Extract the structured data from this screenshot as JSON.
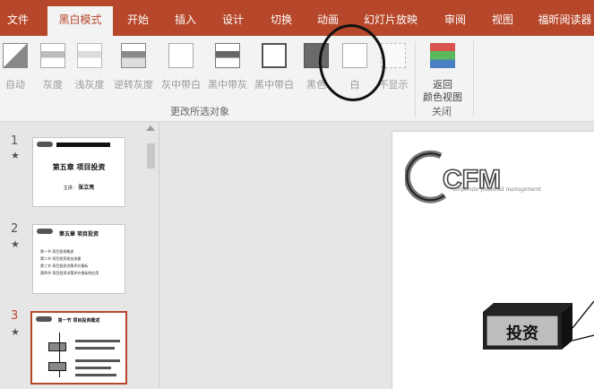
{
  "tabs": [
    {
      "label": "文件",
      "active": false
    },
    {
      "label": "黑白模式",
      "active": true
    },
    {
      "label": "开始",
      "active": false
    },
    {
      "label": "插入",
      "active": false
    },
    {
      "label": "设计",
      "active": false
    },
    {
      "label": "切换",
      "active": false
    },
    {
      "label": "动画",
      "active": false
    },
    {
      "label": "幻灯片放映",
      "active": false
    },
    {
      "label": "审阅",
      "active": false
    },
    {
      "label": "视图",
      "active": false
    },
    {
      "label": "福昕阅读器",
      "active": false
    }
  ],
  "ribbon": {
    "buttons": [
      {
        "label": "自动",
        "icon": "auto-icon"
      },
      {
        "label": "灰度",
        "icon": "grayscale-icon"
      },
      {
        "label": "浅灰度",
        "icon": "light-grayscale-icon"
      },
      {
        "label": "逆转灰度",
        "icon": "inverse-grayscale-icon"
      },
      {
        "label": "灰中带白",
        "icon": "gray-with-white-icon"
      },
      {
        "label": "黑中带灰",
        "icon": "black-with-gray-icon"
      },
      {
        "label": "黑中带白",
        "icon": "black-with-white-icon"
      },
      {
        "label": "黑色",
        "icon": "black-icon"
      },
      {
        "label": "白",
        "icon": "white-icon"
      },
      {
        "label": "不显示",
        "icon": "dont-show-icon"
      }
    ],
    "group_label": "更改所选对象",
    "return_label_line1": "返回",
    "return_label_line2": "颜色视图",
    "close_group_label": "关闭"
  },
  "slides": [
    {
      "number": "1",
      "title": "第五章  项目投资",
      "subtitle": "主讲：",
      "subtitle_name": "张立亮"
    },
    {
      "number": "2",
      "title": "第五章  项目投资",
      "items": [
        "第一节  项目投资概述",
        "第二节  项目投资现金流量",
        "第三节  项目投资决策评价指标",
        "第四节  项目投资决策评价指标的应用"
      ]
    },
    {
      "number": "3",
      "title": "第一节  项目投资概述"
    }
  ],
  "main": {
    "logo_text": "CFM",
    "logo_subtitle": "corporate financial management",
    "box_label": "投资"
  },
  "colors": {
    "accent": "#b7472a",
    "ribbon_bg": "#f3f3f3",
    "pane_bg": "#e6e6e6"
  }
}
